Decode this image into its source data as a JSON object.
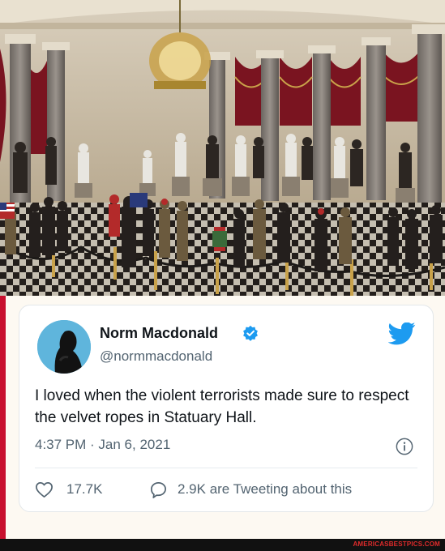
{
  "photo": {
    "icon": "statuary-hall-photo"
  },
  "tweet": {
    "display_name": "Norm Macdonald",
    "handle": "@normmacdonald",
    "text": "I loved when the violent terrorists made sure to respect the velvet ropes in Statuary Hall.",
    "timestamp": "4:37 PM · Jan 6, 2021",
    "likes": "17.7K",
    "replies": "2.9K are Tweeting about this",
    "icons": {
      "verified": "verified-badge-icon",
      "brand": "twitter-bird-icon",
      "info": "info-icon",
      "like": "heart-icon",
      "reply": "speech-bubble-icon"
    }
  },
  "watermark": "AMERICASBESTPICS.COM",
  "colors": {
    "accent": "#1d9bf0",
    "frame_red": "#c8102e",
    "text": "#0f1419",
    "muted": "#536471",
    "background": "#fdf9f2"
  }
}
